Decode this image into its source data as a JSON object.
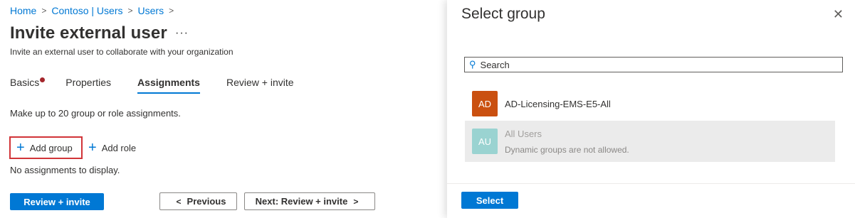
{
  "breadcrumb": [
    "Home",
    "Contoso | Users",
    "Users"
  ],
  "page": {
    "title": "Invite external user",
    "more": "···",
    "subtitle": "Invite an external user to collaborate with your organization"
  },
  "tabs": [
    {
      "label": "Basics",
      "has_error_dot": true
    },
    {
      "label": "Properties"
    },
    {
      "label": "Assignments",
      "active": true
    },
    {
      "label": "Review + invite"
    }
  ],
  "assignments": {
    "info": "Make up to 20 group or role assignments.",
    "add_group": "Add group",
    "add_role": "Add role",
    "empty": "No assignments to display."
  },
  "footer": {
    "review_invite": "Review + invite",
    "previous": "Previous",
    "next": "Next: Review + invite"
  },
  "panel": {
    "title": "Select group",
    "close_icon": "close-icon",
    "search_placeholder": "Search",
    "groups": [
      {
        "initials": "AD",
        "name": "AD-Licensing-EMS-E5-All",
        "color": "#ca5010",
        "disabled": false
      },
      {
        "initials": "AU",
        "name": "All Users",
        "subtext": "Dynamic groups are not allowed.",
        "color": "#9ad3d1",
        "disabled": true
      }
    ],
    "select_button": "Select"
  },
  "colors": {
    "accent": "#0078d4",
    "error": "#a4262c",
    "highlight_border": "#d13438"
  }
}
